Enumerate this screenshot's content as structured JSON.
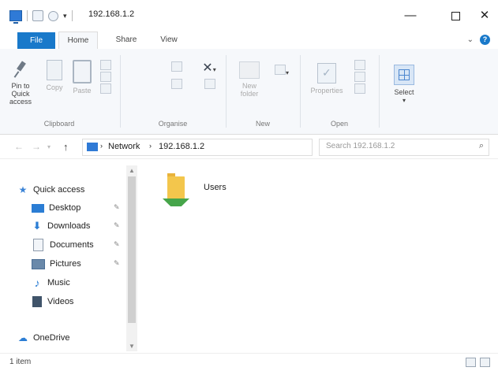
{
  "window": {
    "title": "192.168.1.2"
  },
  "tabs": {
    "file": "File",
    "home": "Home",
    "share": "Share",
    "view": "View"
  },
  "ribbon": {
    "clipboard": {
      "label": "Clipboard",
      "pin": "Pin to Quick access",
      "copy": "Copy",
      "paste": "Paste"
    },
    "organise": {
      "label": "Organise"
    },
    "new": {
      "label": "New",
      "new_folder": "New folder"
    },
    "open": {
      "label": "Open",
      "properties": "Properties"
    },
    "select": {
      "label": "Select"
    }
  },
  "address": {
    "crumbs": [
      "Network",
      "192.168.1.2"
    ],
    "search_placeholder": "Search 192.168.1.2"
  },
  "navpane": {
    "items": [
      {
        "label": "Quick access",
        "icon": "star-icon"
      },
      {
        "label": "Desktop",
        "icon": "desktop-icon",
        "pinned": true
      },
      {
        "label": "Downloads",
        "icon": "download-icon",
        "pinned": true
      },
      {
        "label": "Documents",
        "icon": "documents-icon",
        "pinned": true
      },
      {
        "label": "Pictures",
        "icon": "pictures-icon",
        "pinned": true
      },
      {
        "label": "Music",
        "icon": "music-icon"
      },
      {
        "label": "Videos",
        "icon": "videos-icon"
      },
      {
        "label": "OneDrive",
        "icon": "onedrive-icon"
      }
    ]
  },
  "content": {
    "items": [
      {
        "name": "Users",
        "type": "shared-folder"
      }
    ]
  },
  "status": {
    "text": "1 item"
  },
  "colors": {
    "accent": "#1979ca",
    "folder": "#f3c64c",
    "share_overlay": "#46a54a"
  }
}
